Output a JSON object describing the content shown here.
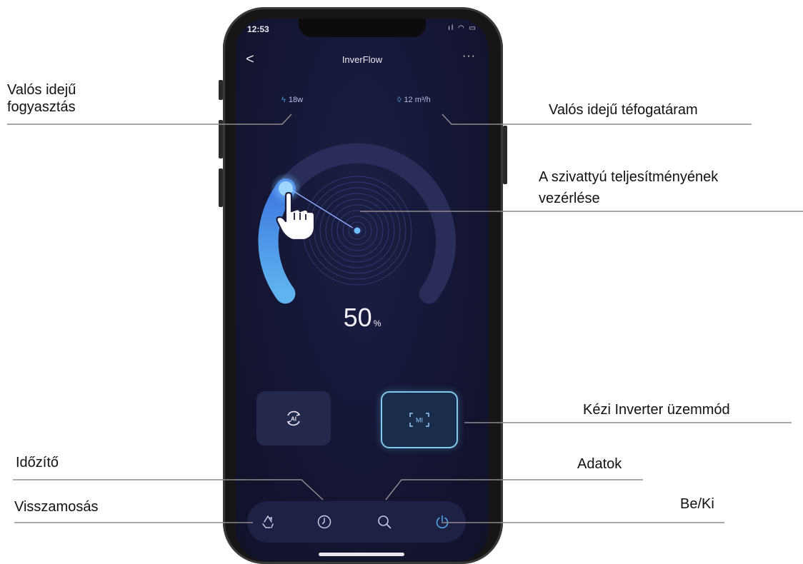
{
  "status_bar": {
    "time": "12:53",
    "icons": "ıl ◠ ▭"
  },
  "header": {
    "back": "<",
    "title": "InverFlow",
    "more": "···"
  },
  "stats": {
    "power": "18w",
    "flow": "12 m³/h",
    "power_icon": "bolt-icon",
    "flow_icon": "drop-icon"
  },
  "pump": {
    "value": "50",
    "unit": "%",
    "level": 0.5
  },
  "modes": [
    {
      "name": "AI"
    },
    {
      "name": "MI"
    }
  ],
  "nav": [
    "recycle-icon",
    "clock-icon",
    "search-icon",
    "power-icon"
  ],
  "annotations": {
    "power": "Valós idejű fogyasztás",
    "flow": "Valós idejű téfogatáram",
    "control_line1": "A szivattyú teljesítményének",
    "control_line2": "vezérlése",
    "manual": "Kézi Inverter üzemmód",
    "timer": "Időzítő",
    "data": "Adatok",
    "backwash": "Visszamosás",
    "onoff": "Be/Ki"
  },
  "colors": {
    "screen_bg": "#141634",
    "accent": "#4a9de0",
    "active_border": "#7fc8ef"
  }
}
